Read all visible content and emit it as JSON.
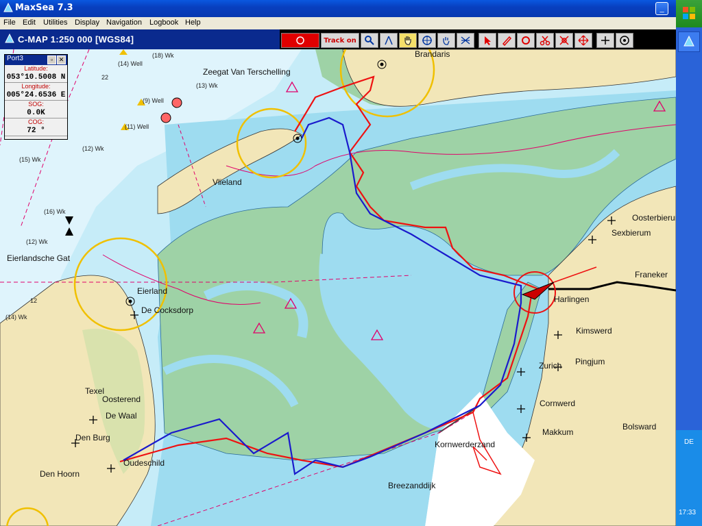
{
  "window": {
    "title": "MaxSea 7.3",
    "minimize": "_",
    "maximize": "□",
    "close": "✕"
  },
  "menu": [
    "File",
    "Edit",
    "Utilities",
    "Display",
    "Navigation",
    "Logbook",
    "Help"
  ],
  "chart_header": {
    "title": "C-MAP  1:250 000 [WGS84]"
  },
  "toolbar": {
    "track_label": "Track on"
  },
  "info_panel": {
    "title": "Port3",
    "latitude_label": "Latitude:",
    "latitude": "053°10.5008 N",
    "longitude_label": "Longitude:",
    "longitude": "005°24.6536 E",
    "sog_label": "SOG:",
    "sog": "0.0K",
    "cog_label": "COG:",
    "cog": "72 °"
  },
  "map_labels": {
    "brandaris": "Brandaris",
    "zeegat": "Zeegat Van Terschelling",
    "vlieland": "Vlieland",
    "vlieland_town": "Vlieland",
    "eierlandsche_gat": "Eierlandsche Gat",
    "eierland": "Eierland",
    "de_cocksdorp": "De Cocksdorp",
    "texel": "Texel",
    "oosterend": "Oosterend",
    "de_waal": "De Waal",
    "den_burg": "Den Burg",
    "den_hoorn": "Den Hoorn",
    "oudeschild": "Oudeschild",
    "harlingen": "Harlingen",
    "franeker": "Franeker",
    "oosterbierum": "Oosterbierum",
    "sexbierum": "Sexbierum",
    "kimswerd": "Kimswerd",
    "zurich": "Zurich",
    "pingjum": "Pingjum",
    "cornwerd": "Cornwerd",
    "makkum": "Makkum",
    "bolsward": "Bolsward",
    "kornwerderzand": "Kornwerderzand",
    "breezanddijk": "Breezanddijk"
  },
  "depth_labels": [
    "(14) Well",
    "(18) Wk",
    "(9) Well",
    "(11) Well",
    "(12) Wk",
    "(15) Wk",
    "(13) Wk",
    "(16) Wk",
    "(12) Wk",
    "(14) Wk",
    "22",
    "12"
  ],
  "taskbar": {
    "language": "DE",
    "clock": "17:33"
  },
  "colors": {
    "sea": "#c6ecf8",
    "shallow": "#9edcf0",
    "land": "#f2e6b8",
    "tidal_flat": "#9ed2a6",
    "route_red": "#ee1111",
    "route_blue": "#1a1acc",
    "circle": "#f0c000",
    "track": "#e0006a"
  }
}
